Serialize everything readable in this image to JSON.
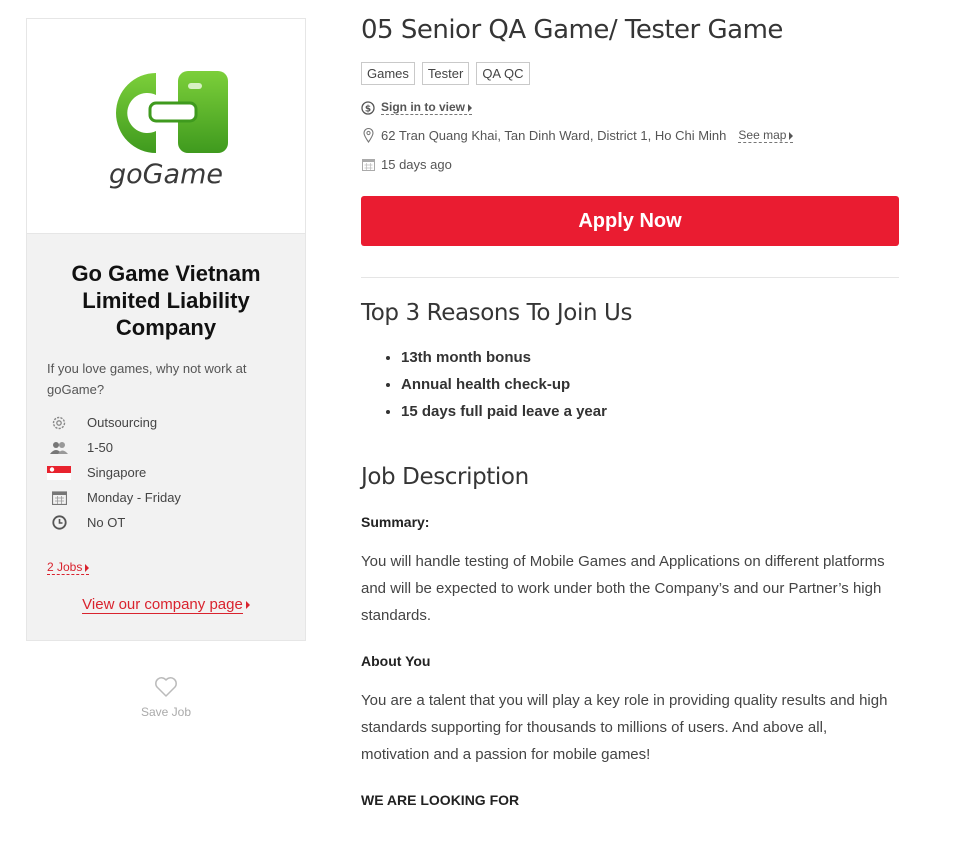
{
  "company": {
    "logo_text": "goGame",
    "name": "Go Game Vietnam Limited Liability Company",
    "tagline": "If you love games, why not work at goGame?",
    "facts": [
      {
        "icon": "gear-icon",
        "label": "Outsourcing"
      },
      {
        "icon": "people-icon",
        "label": "1-50"
      },
      {
        "icon": "singapore-flag-icon",
        "label": "Singapore"
      },
      {
        "icon": "calendar-icon",
        "label": "Monday - Friday"
      },
      {
        "icon": "clock-icon",
        "label": "No OT"
      }
    ],
    "jobs_link": "2 Jobs",
    "company_page_link": "View our company page"
  },
  "save_job": {
    "label": "Save Job"
  },
  "job": {
    "title": "05 Senior QA Game/ Tester Game",
    "tags": [
      "Games",
      "Tester",
      "QA QC"
    ],
    "salary_link": "Sign in to view",
    "address": "62 Tran Quang Khai, Tan Dinh Ward, District 1, Ho Chi Minh",
    "see_map": "See map",
    "posted": "15 days ago",
    "apply_label": "Apply Now"
  },
  "reasons": {
    "title": "Top 3 Reasons To Join Us",
    "items": [
      "13th month bonus",
      "Annual health check-up",
      "15 days full paid leave a year"
    ]
  },
  "description": {
    "title": "Job Description",
    "summary_heading": "Summary:",
    "summary_text": "You will handle testing of Mobile Games and Applications on different platforms and will be expected to work under both the Company’s and our Partner’s high standards.",
    "about_heading": "About You",
    "about_text": "You are a talent that you will play a key role in providing quality results and high standards supporting for thousands to millions of users. And above all, motivation and a passion for mobile games!",
    "looking_heading": "WE ARE LOOKING FOR"
  },
  "colors": {
    "accent": "#ea1c31",
    "logo_green": "#5bb52b"
  }
}
